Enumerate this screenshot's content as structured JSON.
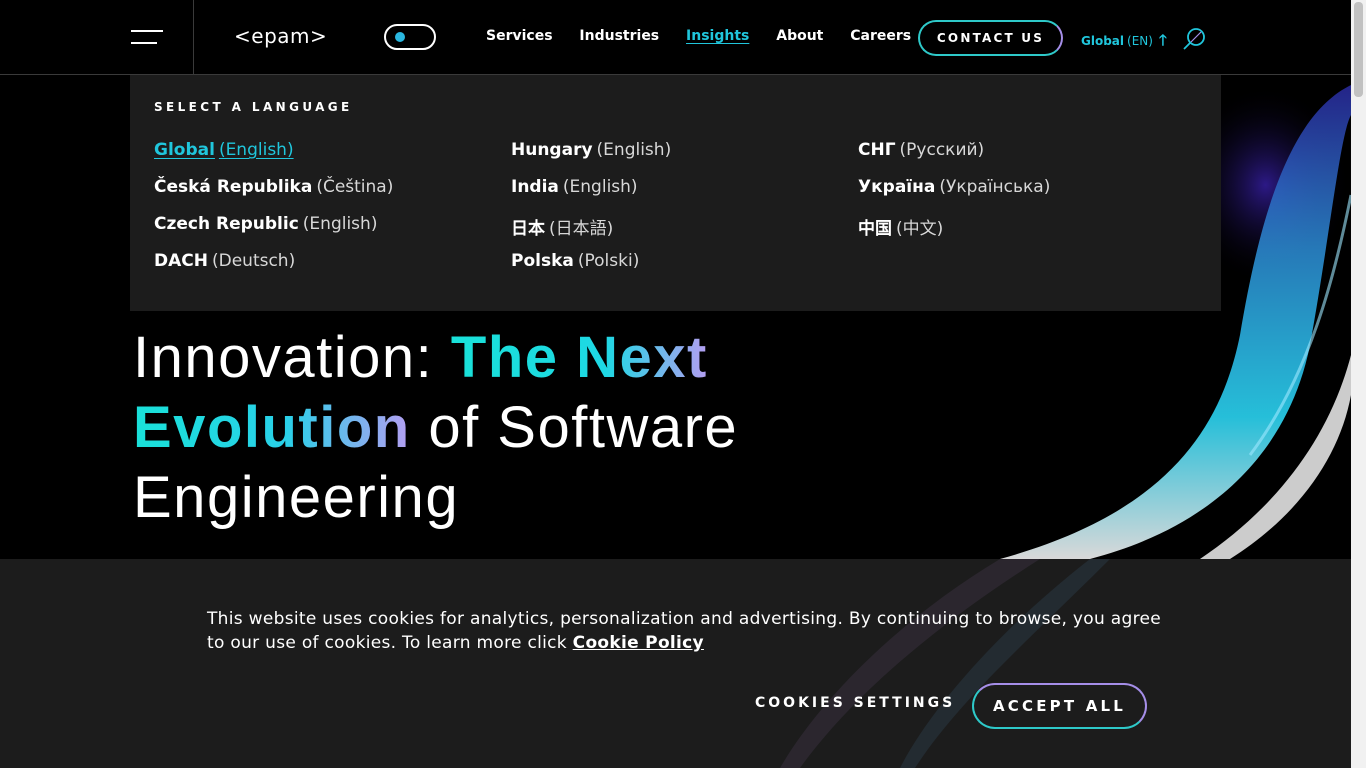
{
  "header": {
    "logo": "<epam>",
    "nav": [
      "Services",
      "Industries",
      "Insights",
      "About",
      "Careers"
    ],
    "active_nav": "Insights",
    "contact_label": "CONTACT US",
    "lang_region": "Global",
    "lang_code": "(EN)"
  },
  "language_panel": {
    "heading": "SELECT A LANGUAGE",
    "columns": [
      [
        {
          "country": "Global",
          "language": "(English)",
          "selected": true
        },
        {
          "country": "Česká Republika",
          "language": "(Čeština)"
        },
        {
          "country": "Czech Republic",
          "language": "(English)"
        },
        {
          "country": "DACH",
          "language": "(Deutsch)"
        }
      ],
      [
        {
          "country": "Hungary",
          "language": "(English)"
        },
        {
          "country": "India",
          "language": "(English)"
        },
        {
          "country": "日本",
          "language": "(日本語)"
        },
        {
          "country": "Polska",
          "language": "(Polski)"
        }
      ],
      [
        {
          "country": "СНГ",
          "language": "(Русский)"
        },
        {
          "country": "Україна",
          "language": "(Українська)"
        },
        {
          "country": "中国",
          "language": "(中文)"
        }
      ]
    ]
  },
  "hero": {
    "title_part1": "Innovation: ",
    "title_highlight1": "The Next",
    "title_highlight2": "Evolution",
    "title_part2": " of Software",
    "title_part3": "Engineering"
  },
  "cookie_banner": {
    "text": "This website uses cookies for analytics, personalization and advertising. By continuing to browse, you agree to our use of cookies. To learn more click ",
    "link": "Cookie Policy",
    "settings_label": "COOKIES SETTINGS",
    "accept_label": "ACCEPT ALL"
  },
  "colors": {
    "accent_cyan": "#20c6dc",
    "accent_violet": "#a58ee8",
    "panel_bg": "#1c1c1c"
  },
  "icons": [
    "hamburger-icon",
    "theme-toggle",
    "arrow-up-icon",
    "search-icon"
  ]
}
